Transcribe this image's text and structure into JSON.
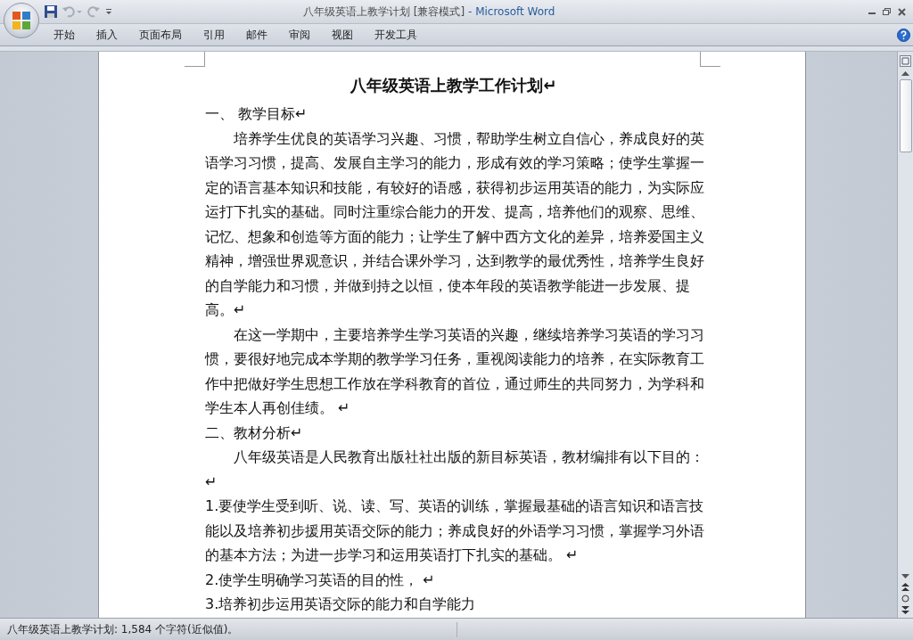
{
  "window": {
    "title": "八年级英语上教学计划 [兼容模式]",
    "app_name": " - Microsoft Word"
  },
  "ribbon_tabs": [
    "开始",
    "插入",
    "页面布局",
    "引用",
    "邮件",
    "审阅",
    "视图",
    "开发工具"
  ],
  "document": {
    "paragraphs": [
      {
        "kind": "title",
        "text": "八年级英语上教学工作计划↵"
      },
      {
        "kind": "heading",
        "text": "一、  教学目标↵"
      },
      {
        "kind": "body",
        "text": "培养学生优良的英语学习兴趣、习惯，帮助学生树立自信心，养成良好的英语学习习惯，提高、发展自主学习的能力，形成有效的学习策略；使学生掌握一定的语言基本知识和技能，有较好的语感，获得初步运用英语的能力，为实际应运打下扎实的基础。同时注重综合能力的开发、提高，培养他们的观察、思维、记忆、想象和创造等方面的能力；让学生了解中西方文化的差异，培养爱国主义精神，增强世界观意识，并结合课外学习，达到教学的最优秀性，培养学生良好的自学能力和习惯，并做到持之以恒，使本年段的英语教学能进一步发展、提高。↵"
      },
      {
        "kind": "body",
        "text": "在这一学期中，主要培养学生学习英语的兴趣，继续培养学习英语的学习习惯，要很好地完成本学期的教学学习任务，重视阅读能力的培养，在实际教育工作中把做好学生思想工作放在学科教育的首位，通过师生的共同努力，为学科和学生本人再创佳绩。 ↵"
      },
      {
        "kind": "heading",
        "text": "二、教材分析↵"
      },
      {
        "kind": "body",
        "text": "八年级英语是人民教育出版社社出版的新目标英语，教材编排有以下目的： ↵"
      },
      {
        "kind": "list",
        "text": "1.要使学生受到听、说、读、写、英语的训练，掌握最基础的语言知识和语言技能以及培养初步援用英语交际的能力；养成良好的外语学习习惯，掌握学习外语的基本方法；为进一步学习和运用英语打下扎实的基础。     ↵"
      },
      {
        "kind": "list",
        "text": "2.使学生明确学习英语的目的性，      ↵"
      },
      {
        "kind": "list",
        "text": "3.培养初步运用英语交际的能力和自学能力"
      }
    ]
  },
  "status_bar": {
    "text": "八年级英语上教学计划: 1,584 个字符(近似值)。"
  }
}
